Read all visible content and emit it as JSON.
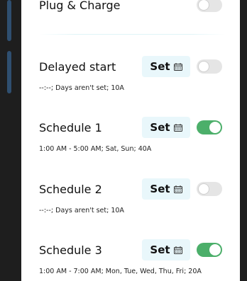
{
  "plug_charge": {
    "label": "Plug & Charge",
    "enabled": false
  },
  "items": [
    {
      "title": "Delayed start",
      "subtitle": "--:--; Days aren't set; 10A",
      "set_label": "Set",
      "enabled": false
    },
    {
      "title": "Schedule 1",
      "subtitle": "1:00 AM - 5:00 AM; Sat, Sun; 40A",
      "set_label": "Set",
      "enabled": true
    },
    {
      "title": "Schedule 2",
      "subtitle": "--:--; Days aren't set; 10A",
      "set_label": "Set",
      "enabled": false
    },
    {
      "title": "Schedule 3",
      "subtitle": "1:00 AM - 7:00 AM; Mon, Tue, Wed, Thu, Fri; 20A",
      "set_label": "Set",
      "enabled": true
    }
  ],
  "icons": {
    "set_button": "calendar-icon"
  },
  "colors": {
    "toggle_on": "#4caf6a",
    "toggle_off": "#e5e5e5",
    "set_button_bg": "#e9f7fb"
  }
}
